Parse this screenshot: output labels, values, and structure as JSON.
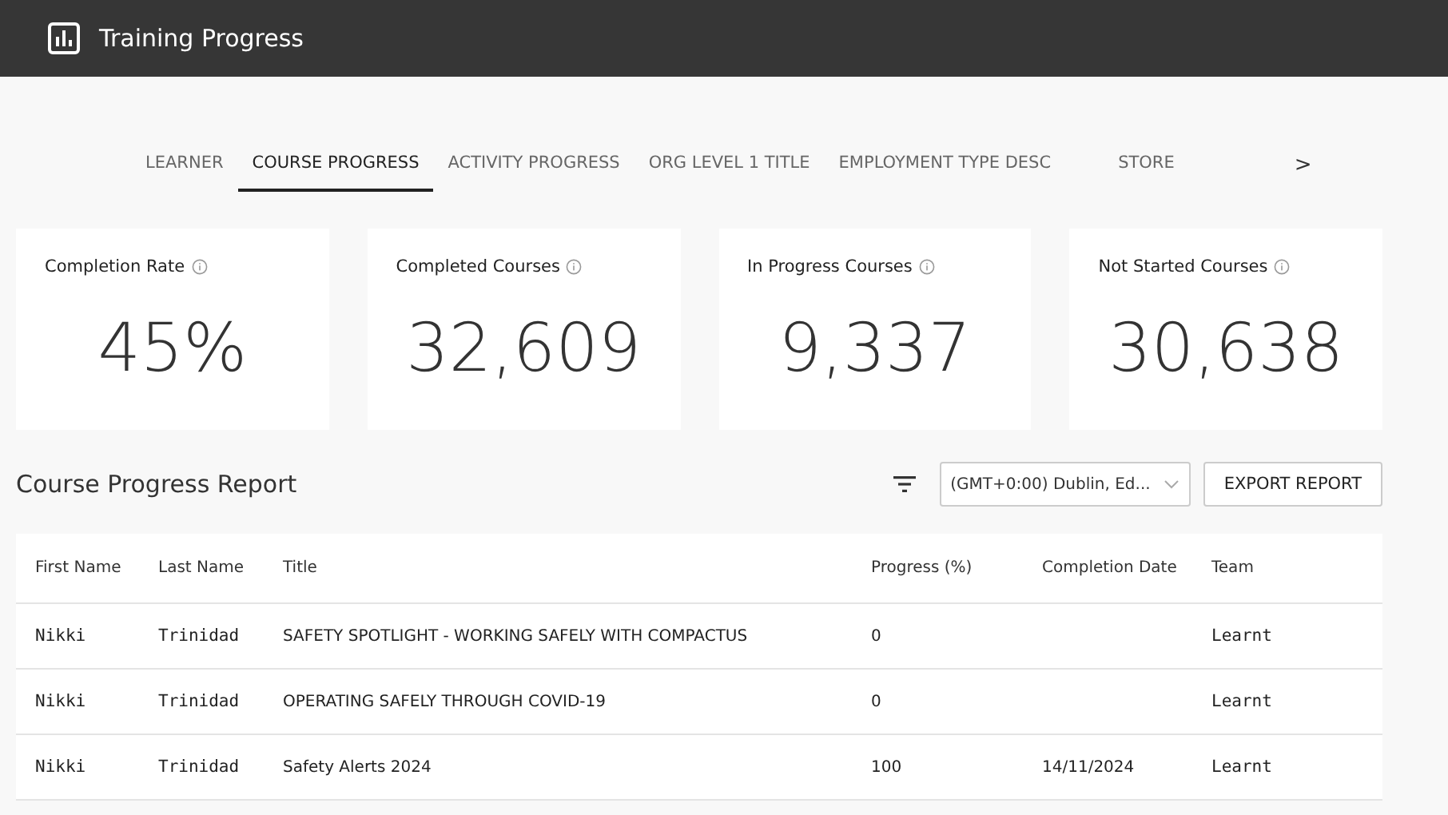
{
  "window": {
    "title": "Training Progress"
  },
  "tabs": [
    {
      "label": "LEARNER",
      "selected": false
    },
    {
      "label": "COURSE PROGRESS",
      "selected": true
    },
    {
      "label": "ACTIVITY PROGRESS",
      "selected": false
    },
    {
      "label": "ORG LEVEL 1 TITLE",
      "selected": false
    },
    {
      "label": "EMPLOYMENT TYPE DESC",
      "selected": false
    },
    {
      "label": "STORE",
      "selected": false
    }
  ],
  "tabs_next": ">",
  "stats": [
    {
      "label": "Completion Rate",
      "value": "45%"
    },
    {
      "label": "Completed Courses",
      "value": "32,609"
    },
    {
      "label": "In Progress Courses",
      "value": "9,337"
    },
    {
      "label": "Not Started Courses",
      "value": "30,638"
    }
  ],
  "report": {
    "title": "Course Progress Report",
    "timezone": "(GMT+0:00) Dublin, Ed...",
    "export_button": "EXPORT REPORT"
  },
  "table": {
    "columns": [
      "First Name",
      "Last Name",
      "Title",
      "Progress (%)",
      "Completion Date",
      "Team"
    ],
    "rows": [
      [
        "Nikki",
        "Trinidad",
        "SAFETY SPOTLIGHT - WORKING SAFELY WITH COMPACTUS",
        "0",
        "",
        "Learnt"
      ],
      [
        "Nikki",
        "Trinidad",
        "OPERATING SAFELY THROUGH COVID-19",
        "0",
        "",
        "Learnt"
      ],
      [
        "Nikki",
        "Trinidad",
        "Safety Alerts 2024",
        "100",
        "14/11/2024",
        "Learnt"
      ]
    ]
  }
}
